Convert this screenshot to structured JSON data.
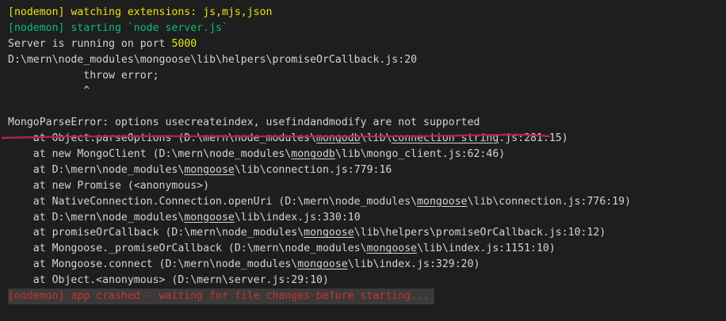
{
  "terminal": {
    "lines": {
      "l0": "[nodemon] watching extensions: js,mjs,json",
      "l1": "[nodemon] starting `node server.js`",
      "l2_prefix": "Server is running on port ",
      "l2_port": "5000",
      "l3": "D:\\mern\\node_modules\\mongoose\\lib\\helpers\\promiseOrCallback.js:20",
      "l4": "            throw error;",
      "l5": "            ^",
      "l6": "",
      "l7": "MongoParseError: options usecreateindex, usefindandmodify are not supported",
      "st0": {
        "a": "    at Object.parseOptions (D:\\mern\\node_modules\\",
        "m": "mongodb",
        "b": "\\lib\\",
        "u2": "connection_string",
        "c": ".js:281:15)"
      },
      "st1": {
        "a": "    at new MongoClient (D:\\mern\\node_modules\\",
        "m": "mongodb",
        "b": "\\lib\\mongo_client.js:62:46)"
      },
      "st2": {
        "a": "    at D:\\mern\\node_modules\\",
        "m": "mongoose",
        "b": "\\lib\\connection.js:779:16"
      },
      "st3": "    at new Promise (<anonymous>)",
      "st4": {
        "a": "    at NativeConnection.Connection.openUri (D:\\mern\\node_modules\\",
        "m": "mongoose",
        "b": "\\lib\\connection.js:776:19)"
      },
      "st5": {
        "a": "    at D:\\mern\\node_modules\\",
        "m": "mongoose",
        "b": "\\lib\\index.js:330:10"
      },
      "st6": {
        "a": "    at promiseOrCallback (D:\\mern\\node_modules\\",
        "m": "mongoose",
        "b": "\\lib\\helpers\\promiseOrCallback.js:10:12)"
      },
      "st7": {
        "a": "    at Mongoose._promiseOrCallback (D:\\mern\\node_modules\\",
        "m": "mongoose",
        "b": "\\lib\\index.js:1151:10)"
      },
      "st8": {
        "a": "    at Mongoose.connect (D:\\mern\\node_modules\\",
        "m": "mongoose",
        "b": "\\lib\\index.js:329:20)"
      },
      "st9": "    at Object.<anonymous> (D:\\mern\\server.js:29:10)",
      "crashed": "[nodemon] app crashed - waiting for file changes before starting..."
    },
    "colors": {
      "background": "#1e1e1e",
      "yellow": "#e5e510",
      "green": "#0dbc79",
      "red": "#cd3131",
      "annotation": "#b0205a"
    }
  }
}
